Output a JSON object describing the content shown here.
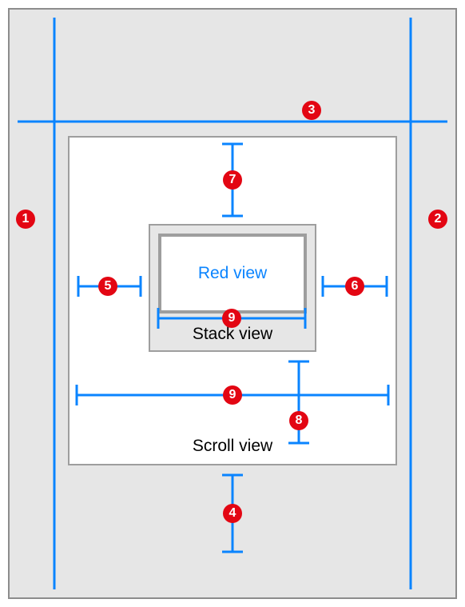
{
  "labels": {
    "redView": "Red view",
    "stackView": "Stack view",
    "scrollView": "Scroll view"
  },
  "callouts": {
    "c1": "1",
    "c2": "2",
    "c3": "3",
    "c4": "4",
    "c5": "5",
    "c6": "6",
    "c7": "7",
    "c8": "8",
    "c9a": "9",
    "c9b": "9"
  },
  "colors": {
    "guide": "#0a84ff",
    "badge": "#e30613",
    "border": "#9e9e9e",
    "bg": "#e6e6e6"
  },
  "meaning": {
    "1": "Scroll view leading guide line (full height)",
    "2": "Scroll view trailing guide line (full height)",
    "3": "Scroll view top guide line (full width)",
    "4": "Bottom spacing between scroll view and superview",
    "5": "Leading spacing between stack view and scroll view content",
    "6": "Trailing spacing between stack view and scroll view content",
    "7": "Top spacing between stack view and scroll view content",
    "8": "Bottom spacing between stack view and scroll view content",
    "9": "Width constraints (stack width / scroll width)"
  }
}
